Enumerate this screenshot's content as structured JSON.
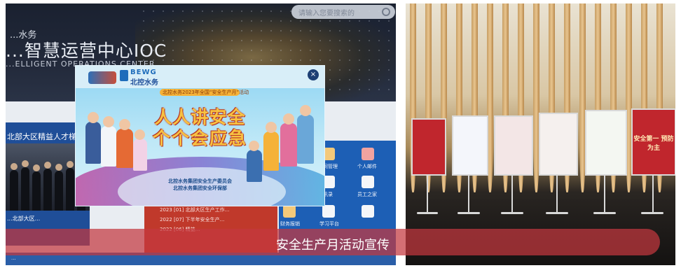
{
  "left_photo": {
    "brand_small": "...水务",
    "brand_big": "...智慧运营中心IOC",
    "brand_en": "...ELLIGENT OPERATIONS CENTER",
    "search_placeholder": "请输入您要搜索的",
    "news_header": "北部大区精益人才梯队",
    "news_caption": "...北部大区...",
    "list_items": [
      "2023 [01] 北部大区生产工作...",
      "2022 [07] 下半年安全生产...",
      "2022 [06] 精益..."
    ],
    "right_tiles": [
      "合同管理",
      "个人邮件",
      "通讯录",
      "员工之家",
      "财务报销",
      "学习平台"
    ],
    "bottom_line": "..."
  },
  "popup": {
    "logo_en": "BEWG",
    "logo_cn": "北控水务",
    "ribbon": "北控水务2023年全国“安全生产月”活动",
    "slogan_line1": "人人讲安全",
    "slogan_line2": "个个会应急",
    "footer_line1": "北控水务集团安全生产委员会",
    "footer_line2": "北控水务集团安全环保部",
    "close_symbol": "×"
  },
  "right_photo": {
    "posters": [
      {
        "text": "...",
        "color": "#c0262d"
      },
      {
        "text": "...",
        "color": "#f4f6fb"
      },
      {
        "text": "...",
        "color": "#f3e6e6"
      },
      {
        "text": "...",
        "color": "#f5f0ee"
      },
      {
        "text": "...",
        "color": "#f4f7f2"
      },
      {
        "text": "安全第一 预防为主",
        "color": "#c0262d"
      }
    ]
  },
  "caption": "安全生产月活动宣传",
  "colors": {
    "caption_bar": "#c4373e",
    "popup_sky": "#8ed4f2",
    "slogan": "#f7c242",
    "news_panel": "#1f4e98"
  }
}
